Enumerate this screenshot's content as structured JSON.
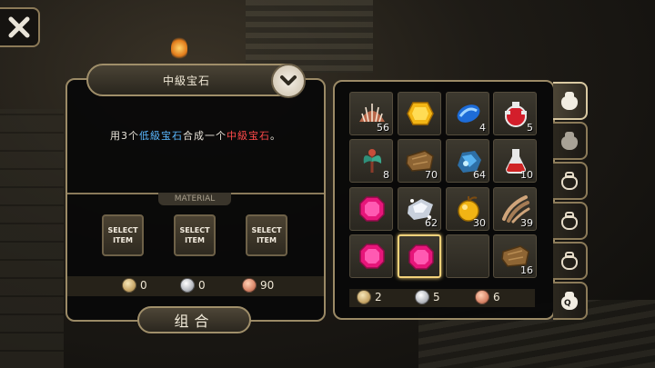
{
  "title": "中級宝石",
  "description": {
    "prefix": "用3个",
    "low_gem": "低級宝石",
    "middle": "合成一个",
    "mid_gem": "中級宝石",
    "suffix": "。"
  },
  "material_label": "MATERIAL",
  "select_slots": [
    {
      "line1": "SELECT",
      "line2": "ITEM"
    },
    {
      "line1": "SELECT",
      "line2": "ITEM"
    },
    {
      "line1": "SELECT",
      "line2": "ITEM"
    }
  ],
  "cost": {
    "gold": "0",
    "silver": "0",
    "copper": "90"
  },
  "combine_label": "组合",
  "inventory": [
    {
      "icon": "shell-icon",
      "count": "56"
    },
    {
      "icon": "yellow-gem-icon",
      "count": ""
    },
    {
      "icon": "blue-crystal-icon",
      "count": "4"
    },
    {
      "icon": "red-potion-icon",
      "count": "5"
    },
    {
      "icon": "herb-plant-icon",
      "count": "8"
    },
    {
      "icon": "leather-scrap-icon",
      "count": "70"
    },
    {
      "icon": "blue-ore-icon",
      "count": "64"
    },
    {
      "icon": "red-flask-icon",
      "count": "10"
    },
    {
      "icon": "pink-gem-icon",
      "count": ""
    },
    {
      "icon": "silver-ore-icon",
      "count": "62"
    },
    {
      "icon": "gold-fruit-icon",
      "count": "30"
    },
    {
      "icon": "claw-icon",
      "count": "39"
    },
    {
      "icon": "pink-gem-icon",
      "count": ""
    },
    {
      "icon": "pink-gem-icon",
      "count": "",
      "selected": true
    },
    {
      "icon": "",
      "count": ""
    },
    {
      "icon": "leather-scrap-icon",
      "count": "16"
    }
  ],
  "inventory_currency": {
    "gold": "2",
    "silver": "5",
    "copper": "6"
  },
  "tabs": [
    {
      "icon": "bag-icon",
      "style": "white",
      "active": true
    },
    {
      "icon": "bag-icon",
      "style": "grey"
    },
    {
      "icon": "bag-icon",
      "style": "outline"
    },
    {
      "icon": "bag-icon",
      "style": "outline"
    },
    {
      "icon": "bag-icon",
      "style": "outline"
    },
    {
      "icon": "quest-bag-icon",
      "style": "white"
    }
  ]
}
